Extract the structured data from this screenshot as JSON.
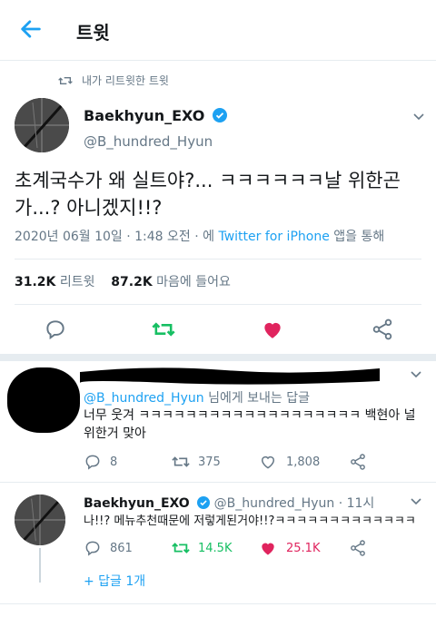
{
  "header": {
    "title": "트윗"
  },
  "retweet_context": {
    "text": "내가 리트윗한 트윗"
  },
  "tweet": {
    "author_name": "Baekhyun_EXO",
    "author_handle": "@B_hundred_Hyun",
    "text": "초계국수가 왜 실트야?... ㅋㅋㅋㅋㅋㅋ날 위한곤가...? 아니겠지!!?",
    "timestamp": "2020년 06월 10일 · 1:48 오전 · 에",
    "source": "Twitter for iPhone",
    "source_suffix": "앱을 통해",
    "retweets_count": "31.2K",
    "retweets_label": "리트윗",
    "likes_count": "87.2K",
    "likes_label": "마음에 들어요"
  },
  "replies": [
    {
      "reply_to_handle": "@B_hundred_Hyun",
      "reply_to_suffix": "님에게 보내는 답글",
      "text": "너무 웃겨 ㅋㅋㅋㅋㅋㅋㅋㅋㅋㅋㅋㅋㅋㅋㅋㅋㅋㅋㅋ 백현아 널 위한거 맞아",
      "reply_count": "8",
      "retweet_count": "375",
      "like_count": "1,808"
    },
    {
      "author_name": "Baekhyun_EXO",
      "author_handle": "@B_hundred_Hyun",
      "time": "· 11시",
      "text": "나!!? 메뉴추천때문에 저렇게된거야!!?ㅋㅋㅋㅋㅋㅋㅋㅋㅋㅋㅋㅋㅋ",
      "reply_count": "861",
      "retweet_count": "14.5K",
      "like_count": "25.1K"
    }
  ],
  "more_replies": "+ 답글 1개",
  "colors": {
    "accent": "#1da1f2",
    "retweet_green": "#17bf63",
    "like_red": "#e0245e",
    "muted": "#657786"
  }
}
